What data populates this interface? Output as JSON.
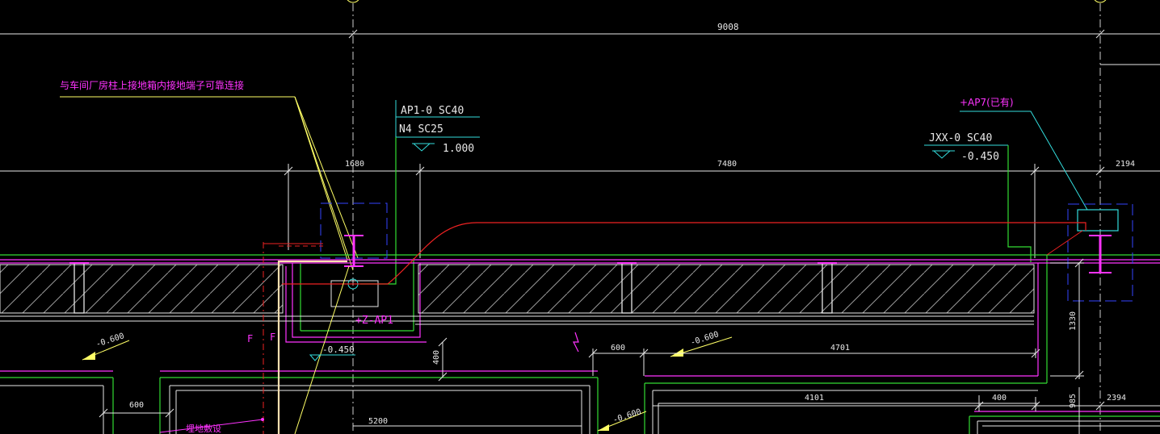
{
  "colors": {
    "background": "#000000",
    "dim_white": "#e8e8e8",
    "magenta": "#ff33ff",
    "yellow": "#ffff66",
    "green": "#33dd33",
    "cyan": "#33dddd",
    "red": "#ee2222",
    "blue": "#3344ff",
    "cream": "#ffe0b0"
  },
  "dimensions": {
    "top_span": "9008",
    "left_1680": "1680",
    "mid_7480": "7480",
    "right_2194": "2194",
    "d600_a": "600",
    "d4701": "4701",
    "d1330": "1330",
    "d400_left": "400",
    "d4101": "4101",
    "d400_right": "400",
    "d985": "985",
    "d2394": "2394",
    "d600_b": "600",
    "d5200": "5200"
  },
  "annotations": {
    "ground_note": "与车间厂房柱上接地箱内接地端子可靠连接",
    "ap1_cable": "AP1-0 SC40",
    "n4_cable": "N4 SC25",
    "elev_ap1": "1.000",
    "ap7_label": "+AP7(已有)",
    "jxx_cable": "JXX-0 SC40",
    "elev_jxx": "-0.450",
    "zap1_label": "+Z-AP1",
    "elev_pit": "-0.450",
    "slope_left": "-0.600",
    "slope_mid": "-0.600",
    "slope_bottom": "-0.600",
    "f_mark_1": "F",
    "f_mark_2": "F",
    "bottom_note": "埋地敷设"
  }
}
